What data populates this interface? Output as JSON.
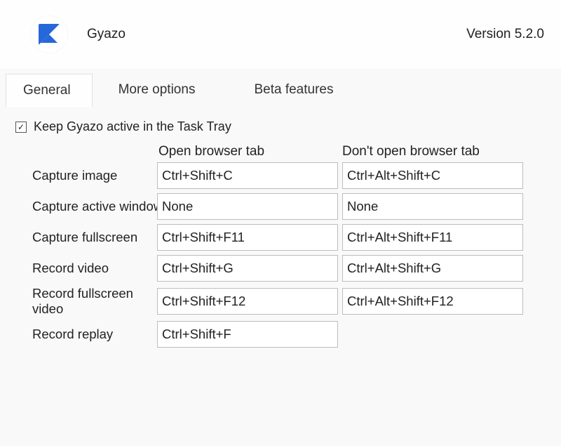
{
  "header": {
    "app_name": "Gyazo",
    "version": "Version 5.2.0"
  },
  "tabs": {
    "general": "General",
    "more_options": "More options",
    "beta_features": "Beta features"
  },
  "checkbox": {
    "label": "Keep Gyazo active in the Task Tray",
    "checked": true
  },
  "columns": {
    "open": "Open browser tab",
    "dont_open": "Don't open browser tab"
  },
  "rows": {
    "capture_image": {
      "label": "Capture image",
      "open": "Ctrl+Shift+C",
      "dont_open": "Ctrl+Alt+Shift+C"
    },
    "capture_active_window": {
      "label": "Capture active window",
      "open": "None",
      "dont_open": "None"
    },
    "capture_fullscreen": {
      "label": "Capture fullscreen",
      "open": "Ctrl+Shift+F11",
      "dont_open": "Ctrl+Alt+Shift+F11"
    },
    "record_video": {
      "label": "Record video",
      "open": "Ctrl+Shift+G",
      "dont_open": "Ctrl+Alt+Shift+G"
    },
    "record_fullscreen_video": {
      "label": "Record fullscreen video",
      "open": "Ctrl+Shift+F12",
      "dont_open": "Ctrl+Alt+Shift+F12"
    },
    "record_replay": {
      "label": "Record replay",
      "open": "Ctrl+Shift+F",
      "dont_open": ""
    }
  }
}
